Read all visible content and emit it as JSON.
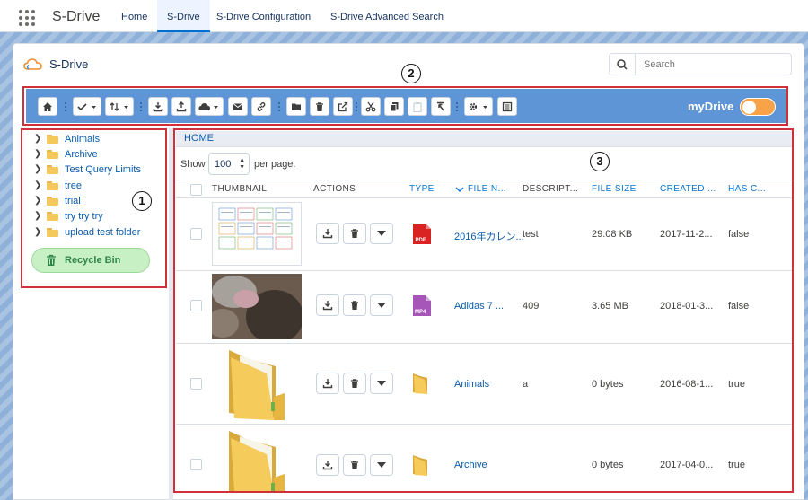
{
  "app": {
    "name": "S-Drive"
  },
  "nav": {
    "tabs": [
      "Home",
      "S-Drive",
      "S-Drive Configuration",
      "S-Drive Advanced Search"
    ],
    "active": "S-Drive"
  },
  "header": {
    "title": "S-Drive"
  },
  "search": {
    "placeholder": "Search",
    "value": ""
  },
  "toolbar": {
    "mydrive_label": "myDrive",
    "mydrive_on": true
  },
  "callouts": [
    "1",
    "2",
    "3"
  ],
  "sidebar": {
    "folders": [
      "Animals",
      "Archive",
      "Test Query Limits",
      "tree",
      "trial",
      "try try try",
      "upload test folder"
    ],
    "recycle_label": "Recycle Bin"
  },
  "main": {
    "breadcrumb": "HOME",
    "show_label": "Show",
    "per_page": "100",
    "per_page_label": "per page.",
    "columns": [
      "THUMBNAIL",
      "ACTIONS",
      "TYPE",
      "FILE N...",
      "DESCRIPT...",
      "FILE SIZE",
      "CREATED ...",
      "HAS C..."
    ],
    "rows": [
      {
        "name": "2016年カレン...",
        "description": "test",
        "size": "29.08 KB",
        "created": "2017-11-2...",
        "has": "false",
        "type": "pdf"
      },
      {
        "name": "Adidas 7 ...",
        "description": "409",
        "size": "3.65 MB",
        "created": "2018-01-3...",
        "has": "false",
        "type": "mp4"
      },
      {
        "name": "Animals",
        "description": "a",
        "size": "0 bytes",
        "created": "2016-08-1...",
        "has": "true",
        "type": "folder"
      },
      {
        "name": "Archive",
        "description": "",
        "size": "0 bytes",
        "created": "2017-04-0...",
        "has": "true",
        "type": "folder"
      }
    ]
  },
  "colors": {
    "accent": "#0070d2",
    "toolbar": "#5e95d6",
    "toggle": "#f9a348",
    "outline": "#d0303a",
    "recycle": "#c7f0c4"
  }
}
